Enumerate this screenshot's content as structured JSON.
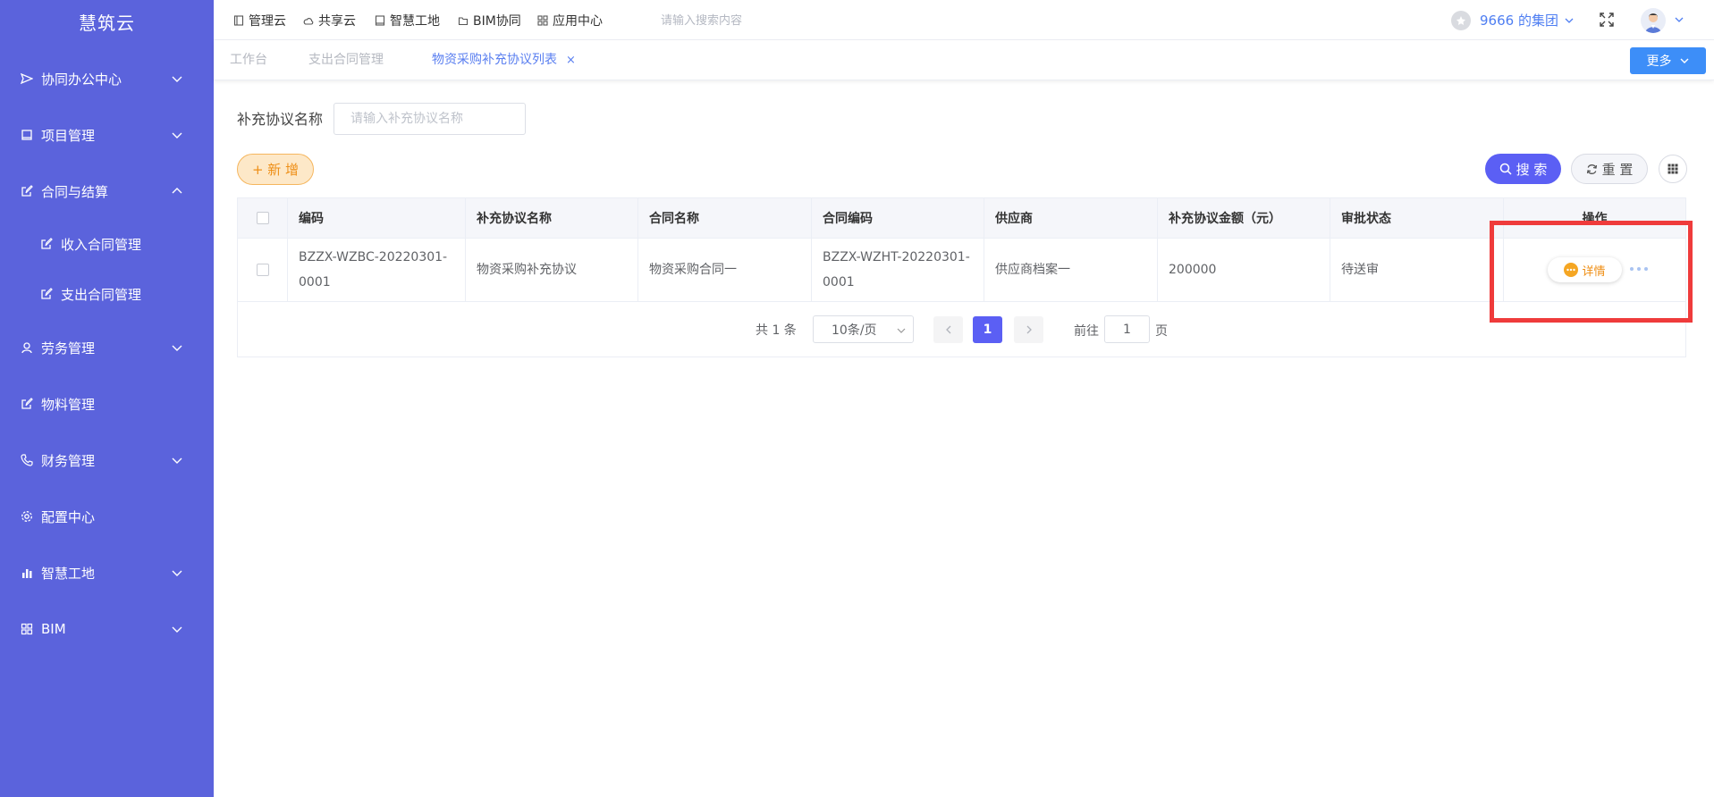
{
  "sidebar": {
    "logo": "慧筑云",
    "items": [
      {
        "label": "协同办公中心",
        "icon": "send-icon",
        "chevron": "down"
      },
      {
        "label": "项目管理",
        "icon": "book-icon",
        "chevron": "down"
      },
      {
        "label": "合同与结算",
        "icon": "edit-icon",
        "chevron": "up"
      },
      {
        "label": "收入合同管理",
        "icon": "edit-icon"
      },
      {
        "label": "支出合同管理",
        "icon": "edit-icon"
      },
      {
        "label": "劳务管理",
        "icon": "worker-icon",
        "chevron": "down"
      },
      {
        "label": "物料管理",
        "icon": "edit-icon"
      },
      {
        "label": "财务管理",
        "icon": "phone-icon",
        "chevron": "down"
      },
      {
        "label": "配置中心",
        "icon": "gear-icon"
      },
      {
        "label": "智慧工地",
        "icon": "bar-chart-icon",
        "chevron": "down"
      },
      {
        "label": "BIM",
        "icon": "grid-icon",
        "chevron": "down"
      }
    ]
  },
  "topbar": {
    "nav": [
      "管理云",
      "共享云",
      "智慧工地",
      "BIM协同",
      "应用中心"
    ],
    "search_placeholder": "请输入搜索内容",
    "org": "9666 的集团"
  },
  "tabs": {
    "items": [
      "工作台",
      "支出合同管理",
      "物资采购补充协议列表"
    ],
    "close": "×",
    "more": "更多"
  },
  "filter": {
    "label": "补充协议名称",
    "placeholder": "请输入补充协议名称"
  },
  "actions": {
    "add": "+ 新 增",
    "search": "搜 索",
    "reset": "重 置"
  },
  "table": {
    "headers": [
      "编码",
      "补充协议名称",
      "合同名称",
      "合同编码",
      "供应商",
      "补充协议金额（元）",
      "审批状态",
      "操作"
    ],
    "rows": [
      [
        "BZZX-WZBC-20220301-0001",
        "物资采购补充协议",
        "物资采购合同一",
        "BZZX-WZHT-20220301-0001",
        "供应商档案一",
        "200000",
        "待送审"
      ]
    ],
    "detail": "详情"
  },
  "pagination": {
    "total": "共 1 条",
    "page_size": "10条/页",
    "current": "1",
    "goto_label": "前往",
    "goto_value": "1",
    "page_label": "页"
  },
  "colors": {
    "sidebar": "#5b63dc",
    "primary": "#5b5ff4",
    "accent_blue": "#3d8ef8",
    "warning": "#ee8f17",
    "highlight": "#ef3b3b"
  }
}
